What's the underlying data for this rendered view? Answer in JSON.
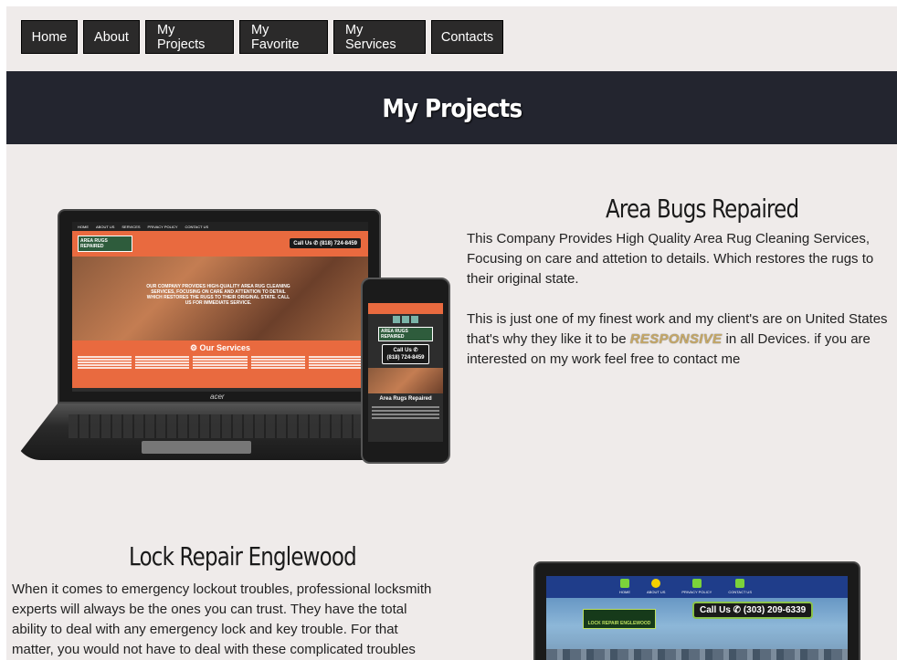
{
  "nav": {
    "items": [
      "Home",
      "About",
      "My Projects",
      "My Favorite",
      "My Services",
      "Contacts"
    ]
  },
  "banner": {
    "title": "My Projects"
  },
  "projects": [
    {
      "title": "Area Bugs Repaired",
      "desc_lines": [
        "This Company Provides High Quality Area Rug Cleaning Services,",
        "Focusing on care and attetion to details. Which restores the rugs to",
        "their original state."
      ],
      "desc2_line1": "This is just one of my finest work and my client's are on United States",
      "desc2_line2_before": "that's why they like it to be ",
      "desc2_highlight": "RESPONSIVE",
      "desc2_line2_after": " in all Devices. if you are",
      "desc2_line3": "interested on my work feel free to contact me",
      "mockup": {
        "nav": [
          "HOME",
          "ABOUT US",
          "SERVICES",
          "PRIVACY POLICY",
          "CONTACT US"
        ],
        "logo": "AREA RUGS REPAIRED",
        "call": "Call Us ✆ (818) 724-8459",
        "hero": "OUR COMPANY PROVIDES HIGH-QUALITY AREA RUG CLEANING SERVICES, FOCUSING ON CARE AND ATTENTION TO DETAIL WHICH RESTORES THE RUGS TO THEIR ORIGINAL STATE. CALL US FOR IMMEDIATE SERVICE.",
        "services": "⚙ Our Services",
        "brand": "acer",
        "phone_call_line1": "Call Us ✆",
        "phone_call_line2": "(818) 724-8459",
        "phone_sub": "Area Rugs Repaired"
      }
    },
    {
      "title": "Lock Repair Englewood",
      "desc_lines": [
        "When it comes to emergency lockout troubles, professional locksmith",
        "experts will always be the ones you can trust. They have the total",
        "ability to deal with any emergency lock and key trouble. For that",
        "matter, you would not have to deal with these complicated troubles"
      ],
      "mockup": {
        "nav": [
          "HOME",
          "ABOUT US",
          "PRIVACY POLICY",
          "CONTACT US"
        ],
        "call": "Call Us ✆ (303) 209-6339",
        "logo": "LOCK REPAIR ENGLEWOOD"
      }
    }
  ]
}
